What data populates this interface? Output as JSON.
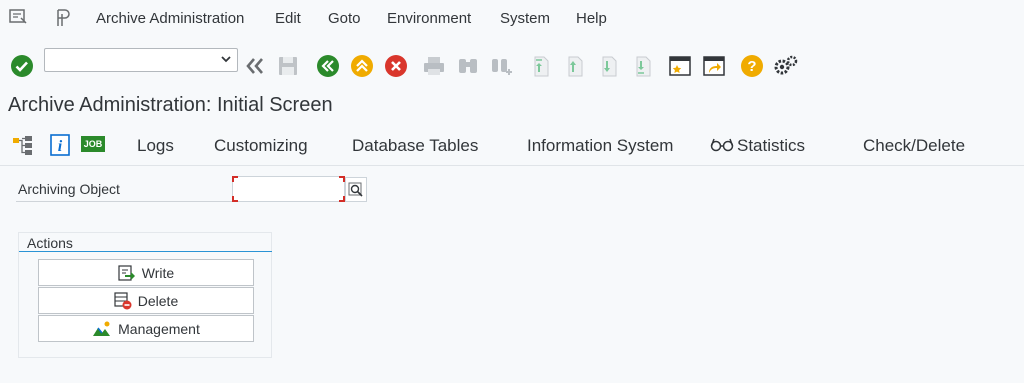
{
  "menu": {
    "items": [
      {
        "label": "Archive Administration"
      },
      {
        "label": "Edit"
      },
      {
        "label": "Goto"
      },
      {
        "label": "Environment"
      },
      {
        "label": "System"
      },
      {
        "label": "Help"
      }
    ]
  },
  "command_field": {
    "value": ""
  },
  "title": "Archive Administration: Initial Screen",
  "app_toolbar": {
    "job_label": "JOB",
    "logs": "Logs",
    "customizing": "Customizing",
    "database_tables": "Database Tables",
    "information_system": "Information System",
    "statistics": "Statistics",
    "check_delete": "Check/Delete"
  },
  "form": {
    "archiving_object_label": "Archiving Object",
    "archiving_object_value": ""
  },
  "actions": {
    "title": "Actions",
    "write": "Write",
    "delete": "Delete",
    "management": "Management"
  },
  "colors": {
    "accent_blue": "#2a93d5",
    "green": "#2b8a2b",
    "orange": "#f0ab00",
    "red": "#d9362c",
    "required_marker": "#d32d27"
  }
}
